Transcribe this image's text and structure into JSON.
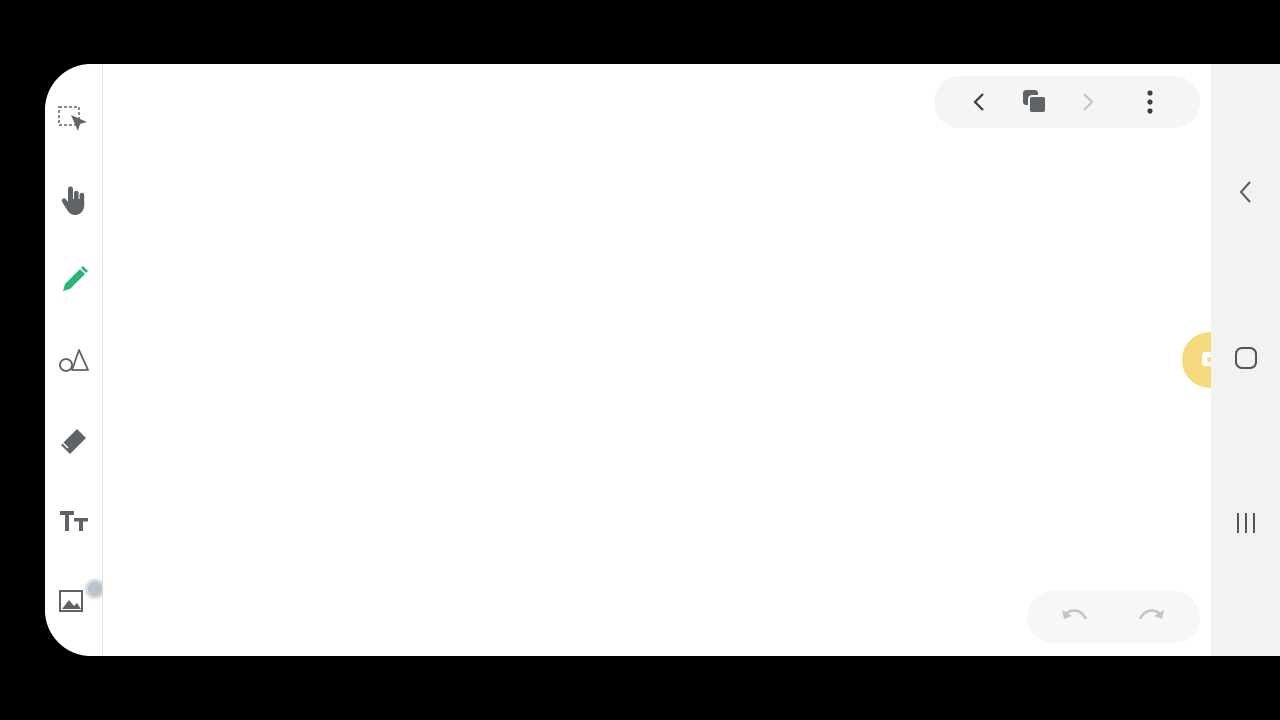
{
  "app": {
    "toolbar_tools": [
      {
        "name": "selection-icon",
        "active": false
      },
      {
        "name": "hand-icon",
        "active": false
      },
      {
        "name": "pencil-icon",
        "active": true
      },
      {
        "name": "shapes-icon",
        "active": false
      },
      {
        "name": "eraser-icon",
        "active": false
      },
      {
        "name": "text-icon",
        "active": false
      },
      {
        "name": "image-icon",
        "active": false
      }
    ],
    "page_nav": [
      "chevron-left-icon",
      "pages-icon",
      "chevron-right-icon",
      "more-vertical-icon"
    ],
    "history": [
      "undo-icon",
      "redo-icon"
    ],
    "floating_action": "screen-record-icon"
  },
  "system_nav": [
    "back-icon",
    "home-icon",
    "recents-icon"
  ],
  "colors": {
    "active_tool": "#2bb673",
    "inactive_tool": "#5f6368",
    "disabled": "#c4c4c4",
    "pill_bg": "#f5f5f5",
    "nav_bg": "#f2f2f2",
    "fab": "#f7d97f"
  }
}
